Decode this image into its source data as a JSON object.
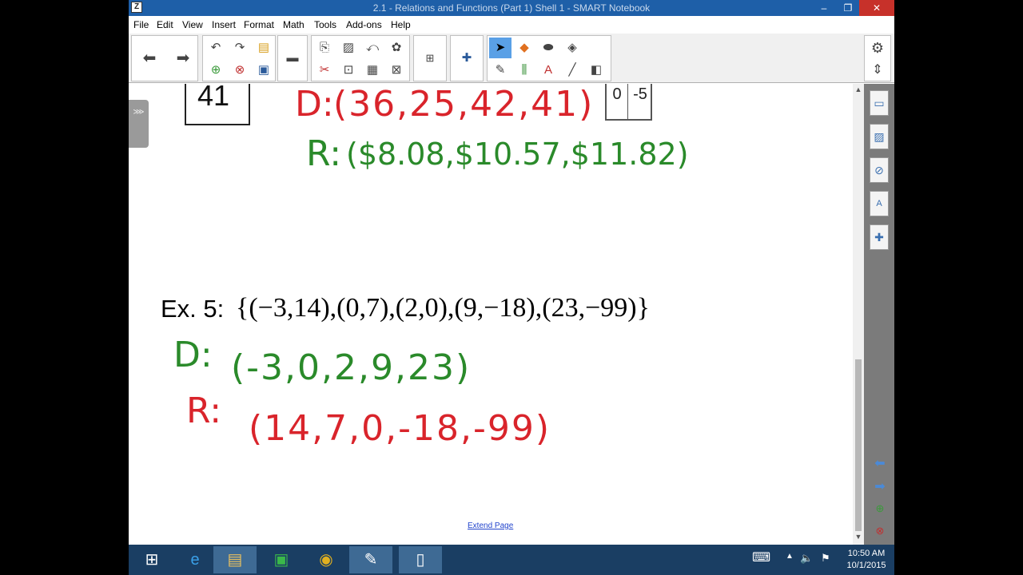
{
  "window": {
    "title": "2.1 - Relations and Functions (Part 1) Shell 1 - SMART Notebook",
    "app_icon_letter": "Z",
    "minimize": "–",
    "restore": "❐",
    "close": "✕"
  },
  "menu": [
    "File",
    "Edit",
    "View",
    "Insert",
    "Format",
    "Math",
    "Tools",
    "Add-ons",
    "Help"
  ],
  "toolbar_right": {
    "settings_icon": "⚙",
    "move_icon": "⇕"
  },
  "canvas": {
    "box_value": "41",
    "table_cells": [
      "0",
      "-5"
    ],
    "top_domain_label": "D:",
    "top_domain_values": "(36,25,42,41)",
    "top_range_label": "R:",
    "top_range_values": "($8.08,$10.57,$11.82)",
    "example_label": "Ex. 5:",
    "example_set": "{(−3,14),(0,7),(2,0),(9,−18),(23,−99)}",
    "domain_label": "D:",
    "domain_values": "(-3,0,2,9,23)",
    "range_label": "R:",
    "range_values": "(14,7,0,-18,-99)",
    "extend_page": "Extend Page"
  },
  "taskbar": {
    "time": "10:50 AM",
    "date": "10/1/2015"
  },
  "colors": {
    "red_ink": "#d9242b",
    "green_ink": "#2a8a2a",
    "titlebar": "#1e5fa8",
    "taskbar": "#1a3e63"
  }
}
